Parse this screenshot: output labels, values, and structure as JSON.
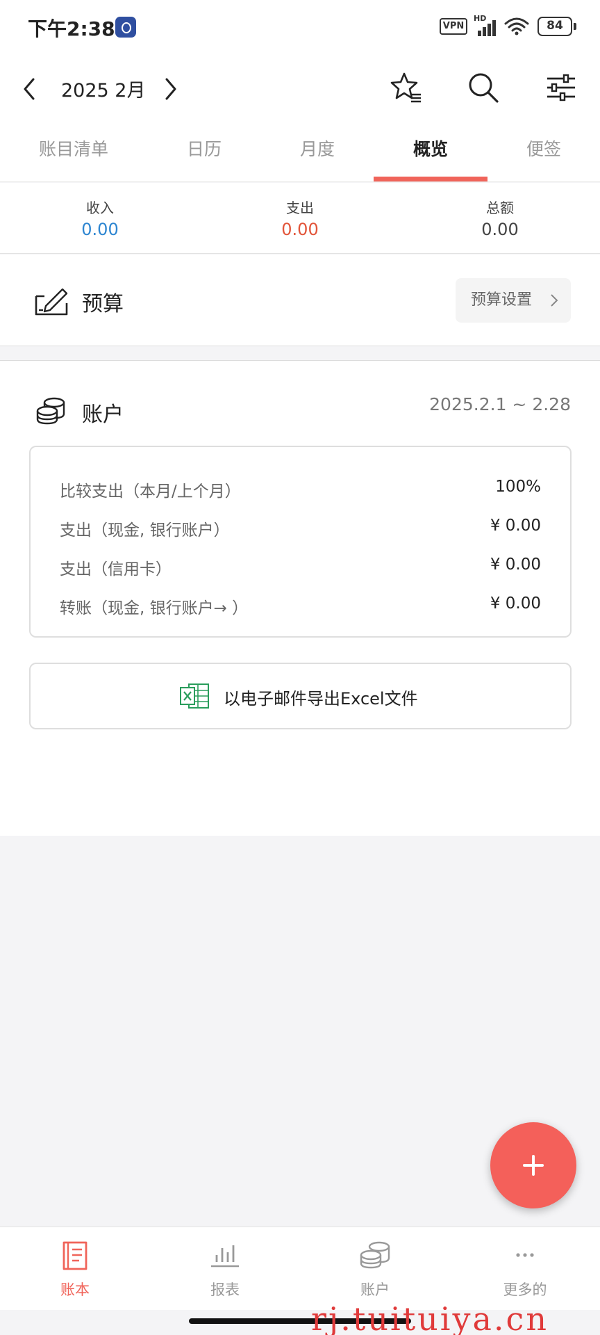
{
  "status_bar": {
    "time": "下午2:38",
    "vpn": "VPN",
    "network": "HD",
    "battery": "84"
  },
  "header": {
    "month_label": "2025 2月"
  },
  "tabs": [
    {
      "label": "账目清单",
      "active": false
    },
    {
      "label": "日历",
      "active": false
    },
    {
      "label": "月度",
      "active": false
    },
    {
      "label": "概览",
      "active": true
    },
    {
      "label": "便签",
      "active": false
    }
  ],
  "summary": {
    "income": {
      "label": "收入",
      "value": "0.00",
      "color": "#2e86d1"
    },
    "expense": {
      "label": "支出",
      "value": "0.00",
      "color": "#e2553a"
    },
    "total": {
      "label": "总额",
      "value": "0.00",
      "color": "#444444"
    }
  },
  "budget": {
    "title": "预算",
    "settings_label": "预算设置"
  },
  "accounts": {
    "title": "账户",
    "date_range": "2025.2.1 ~ 2.28",
    "rows": [
      {
        "label": "比较支出（本月/上个月）",
        "value": "100%"
      },
      {
        "label": "支出（现金, 银行账户）",
        "value": "¥ 0.00"
      },
      {
        "label": "支出（信用卡）",
        "value": "¥ 0.00"
      },
      {
        "label": "转账（现金, 银行账户→ ）",
        "value": "¥ 0.00"
      }
    ],
    "export_label": "以电子邮件导出Excel文件"
  },
  "bottom_nav": [
    {
      "label": "账本",
      "icon": "book-icon",
      "active": true
    },
    {
      "label": "报表",
      "icon": "chart-icon",
      "active": false
    },
    {
      "label": "账户",
      "icon": "coins-icon",
      "active": false
    },
    {
      "label": "更多的",
      "icon": "more-icon",
      "active": false
    }
  ],
  "watermark": "rj.tuituiya.cn",
  "colors": {
    "accent": "#f0645a",
    "income": "#2e86d1",
    "expense": "#e2553a"
  }
}
